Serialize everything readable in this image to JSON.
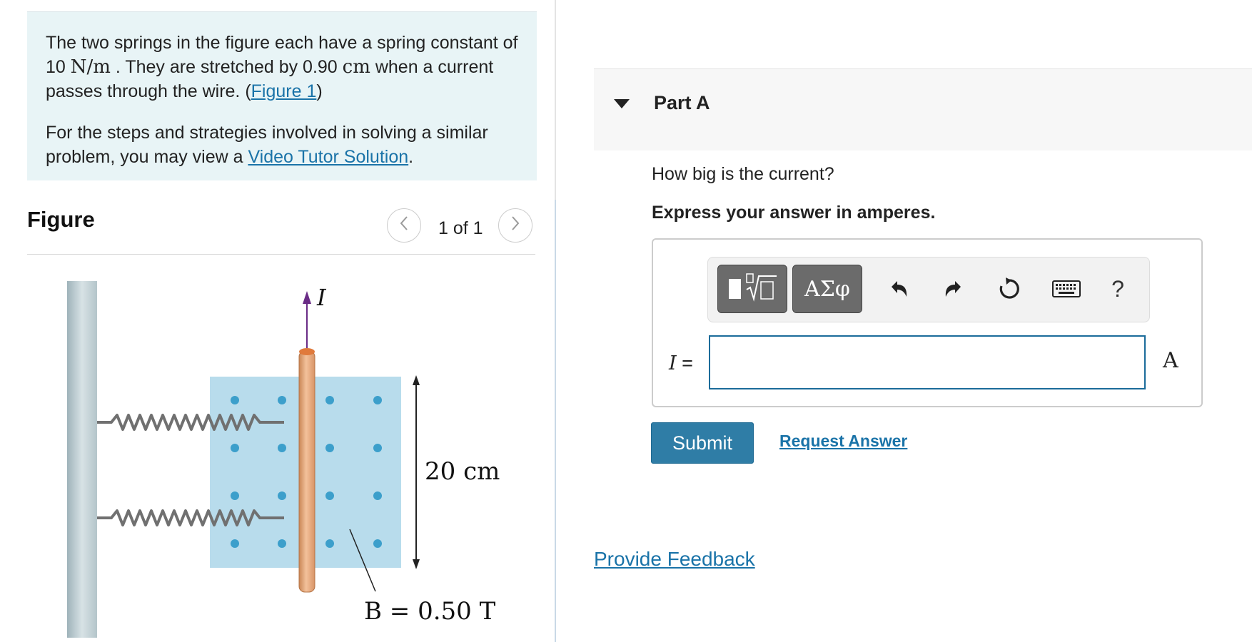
{
  "problem": {
    "text1_a": "The two springs in the figure each have a spring constant of 10 ",
    "k_unit": "N/m",
    "text1_b": " . They are stretched by 0.90 ",
    "stretch_unit": "cm",
    "text1_c": " when a current passes through the wire. (",
    "figure_link": "Figure 1",
    "text1_d": ")",
    "text2_a": "For the steps and strategies involved in solving a similar problem, you may view a ",
    "video_link": "Video Tutor Solution",
    "text2_b": "."
  },
  "figure": {
    "title": "Figure",
    "prev_label": "<",
    "next_label": ">",
    "counter": "1 of 1",
    "current_label": "I",
    "length_label": "20 cm",
    "field_label": "B = 0.50 T"
  },
  "part": {
    "title": "Part A",
    "question": "How big is the current?",
    "instruction": "Express your answer in amperes.",
    "variable": "I",
    "equals": " =",
    "unit": "A",
    "input_value": "",
    "greek_label": "ΑΣφ",
    "help_label": "?",
    "submit_label": "Submit",
    "request_label": "Request Answer"
  },
  "feedback_label": "Provide Feedback",
  "colors": {
    "intro_bg": "#e8f4f6",
    "link": "#1a73a8",
    "submit_bg": "#2f7da6",
    "field_bg": "#b8dcec",
    "field_dot": "#3c9fcb",
    "rod": "#e9a877",
    "current_arrow": "#6a2c86"
  },
  "icons": [
    "templates-icon",
    "undo-icon",
    "redo-icon",
    "reset-icon",
    "keyboard-icon",
    "help-icon"
  ]
}
